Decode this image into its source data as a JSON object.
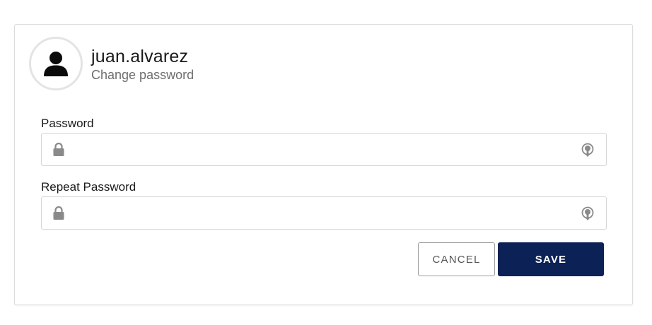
{
  "user": {
    "username": "juan.alvarez",
    "subtitle": "Change password"
  },
  "form": {
    "password": {
      "label": "Password",
      "value": ""
    },
    "repeat_password": {
      "label": "Repeat Password",
      "value": ""
    }
  },
  "actions": {
    "cancel_label": "CANCEL",
    "save_label": "SAVE"
  },
  "icons": {
    "avatar": "user-icon",
    "field_prefix": "lock-icon",
    "field_suffix": "reveal-password-icon"
  },
  "colors": {
    "primary": "#0c2155",
    "icon_gray": "#8a8a8a"
  }
}
